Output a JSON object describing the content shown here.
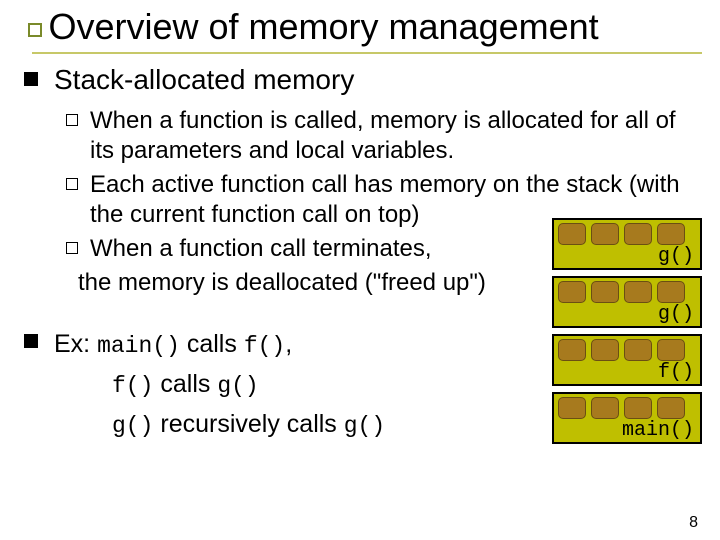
{
  "title": "Overview of memory management",
  "section1": {
    "heading": "Stack-allocated memory",
    "bullets": [
      "When a function is called, memory is allocated for all of its parameters and local variables.",
      "Each active function call has memory on the stack (with the current function call on top)",
      "When a function call terminates,"
    ],
    "bullet3_tail": "the memory is deallocated (\"freed up\")"
  },
  "section2": {
    "lead_a": "Ex: ",
    "lead_b": "main()",
    "lead_c": " calls ",
    "lead_d": "f()",
    "lead_e": ",",
    "line2_a": "f()",
    "line2_b": " calls ",
    "line2_c": "g()",
    "line3_a": "g()",
    "line3_b": " recursively calls ",
    "line3_c": "g()"
  },
  "stack": {
    "frames": [
      "g()",
      "g()",
      "f()",
      "main()"
    ]
  },
  "pagenum": "8"
}
